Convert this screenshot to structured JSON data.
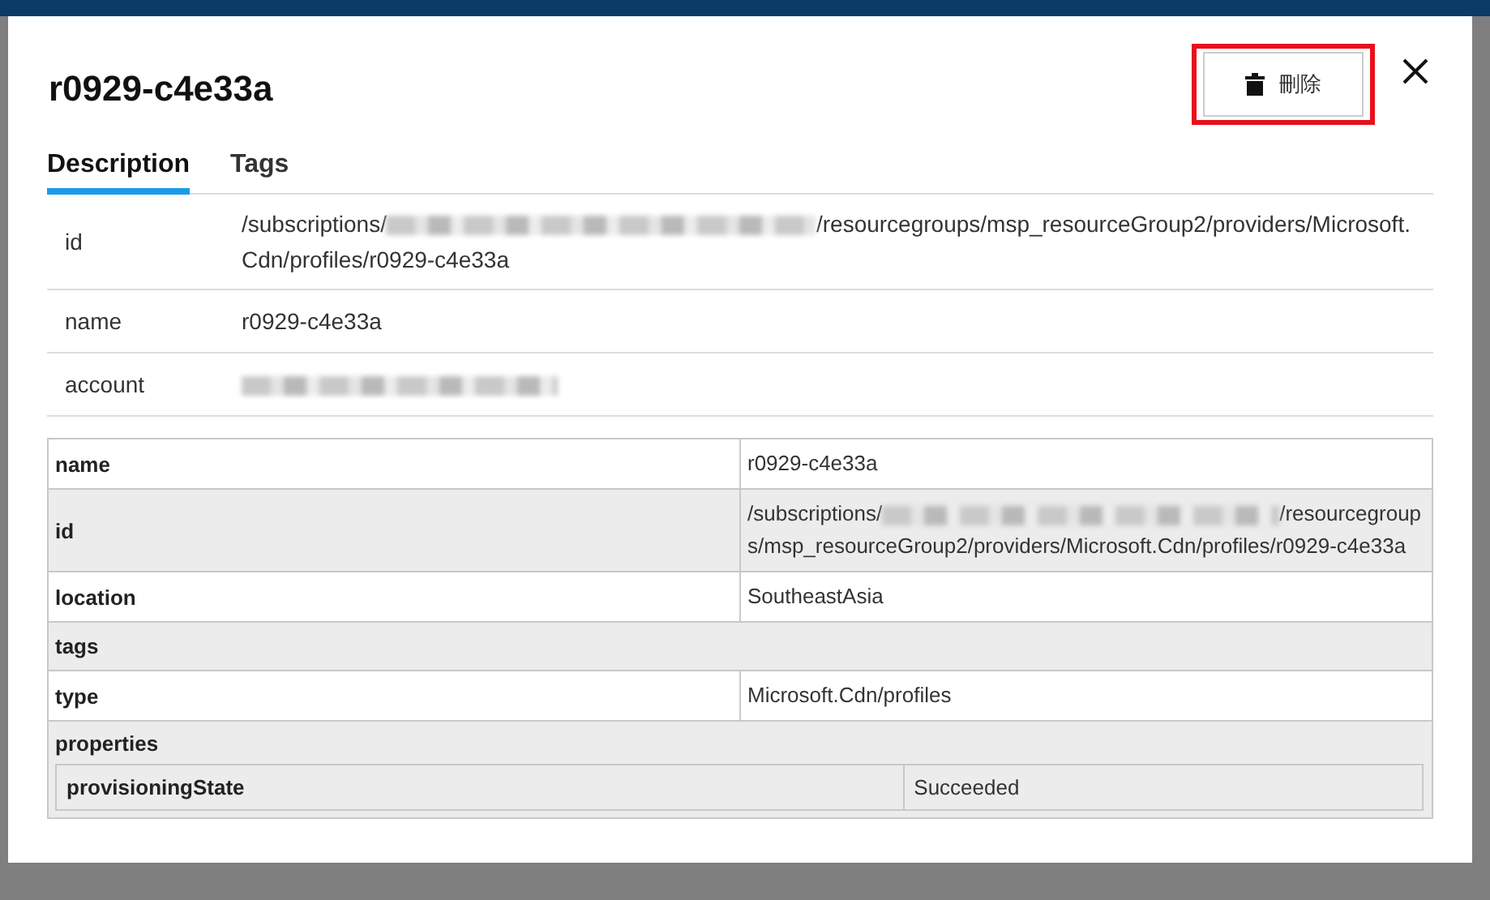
{
  "dialog": {
    "title": "r0929-c4e33a",
    "delete_button": {
      "label": "刪除",
      "highlighted": true
    }
  },
  "tabs": [
    {
      "label": "Description",
      "selected": true
    },
    {
      "label": "Tags",
      "selected": false
    }
  ],
  "description": [
    {
      "label": "id",
      "value_start": "/subscriptions/",
      "redacted": true,
      "value_end": "/resourcegroups/msp_resourceGroup2/providers/Microsoft.Cdn/profiles/r0929-c4e33a"
    },
    {
      "label": "name",
      "value_start": "r0929-c4e33a",
      "redacted": false
    },
    {
      "label": "account",
      "redacted": true
    }
  ],
  "table": {
    "rows": [
      {
        "kind": "pair",
        "key": "name",
        "value_start": "r0929-c4e33a",
        "redacted": false
      },
      {
        "kind": "pair",
        "key": "id",
        "value_start": "/subscriptions/",
        "redacted": true,
        "value_end": "/resourcegroups/msp_resourceGroup2/providers/Microsoft.Cdn/profiles/r0929-c4e33a"
      },
      {
        "kind": "pair",
        "key": "location",
        "value_start": "SoutheastAsia",
        "redacted": false
      },
      {
        "kind": "group",
        "key": "tags"
      },
      {
        "kind": "pair",
        "key": "type",
        "value_start": "Microsoft.Cdn/profiles",
        "redacted": false
      },
      {
        "kind": "nested",
        "key": "properties",
        "children": [
          {
            "key": "provisioningState",
            "value": "Succeeded"
          }
        ]
      }
    ]
  }
}
